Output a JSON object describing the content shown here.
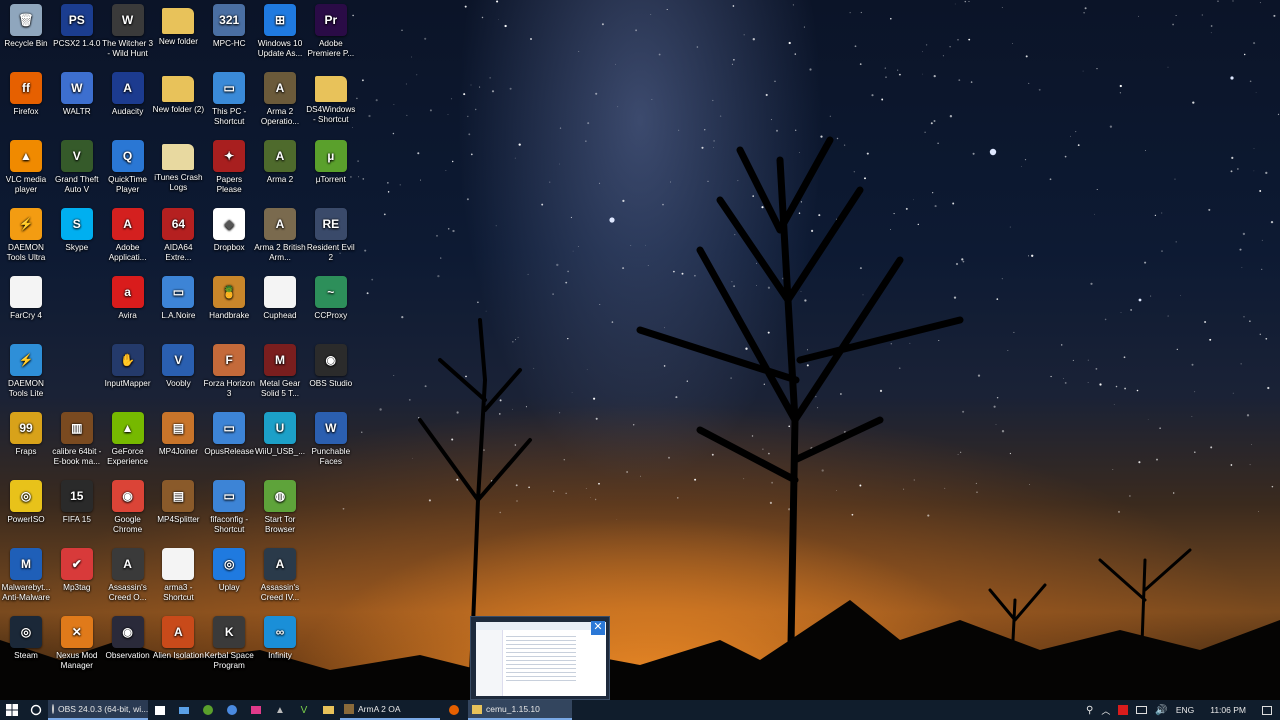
{
  "desktop": {
    "icons": [
      {
        "label": "Recycle Bin",
        "color": "#8fa6bd",
        "glyph": "🗑",
        "icon": "recycle-bin-icon"
      },
      {
        "label": "PCSX2 1.4.0",
        "color": "#1b3d8f",
        "glyph": "PS",
        "icon": "pcsx2-icon"
      },
      {
        "label": "The Witcher 3 - Wild Hunt",
        "color": "#3a3a3a",
        "glyph": "W",
        "icon": "witcher-icon"
      },
      {
        "label": "New folder",
        "color": "#e8c25a",
        "glyph": "",
        "icon": "folder-icon"
      },
      {
        "label": "MPC-HC",
        "color": "#4a6fa3",
        "glyph": "321",
        "icon": "mpc-hc-icon"
      },
      {
        "label": "Windows 10 Update As...",
        "color": "#1f7ae0",
        "glyph": "⊞",
        "icon": "windows-update-icon"
      },
      {
        "label": "Adobe Premiere P...",
        "color": "#2a0b46",
        "glyph": "Pr",
        "icon": "premiere-icon"
      },
      {
        "label": "Firefox",
        "color": "#e66000",
        "glyph": "ff",
        "icon": "firefox-icon"
      },
      {
        "label": "WALTR",
        "color": "#3d6fcf",
        "glyph": "W",
        "icon": "waltr-icon"
      },
      {
        "label": "Audacity",
        "color": "#1c3b8f",
        "glyph": "A",
        "icon": "audacity-icon"
      },
      {
        "label": "New folder (2)",
        "color": "#e8c25a",
        "glyph": "",
        "icon": "folder-icon"
      },
      {
        "label": "This PC - Shortcut",
        "color": "#3a8ad8",
        "glyph": "▭",
        "icon": "this-pc-icon"
      },
      {
        "label": "Arma 2 Operatio...",
        "color": "#6b5a3a",
        "glyph": "A",
        "icon": "arma-icon"
      },
      {
        "label": "DS4Windows - Shortcut",
        "color": "#e8c25a",
        "glyph": "",
        "icon": "folder-icon"
      },
      {
        "label": "VLC media player",
        "color": "#f08a00",
        "glyph": "▲",
        "icon": "vlc-icon"
      },
      {
        "label": "Grand Theft Auto V",
        "color": "#355a2a",
        "glyph": "V",
        "icon": "gta-icon"
      },
      {
        "label": "QuickTime Player",
        "color": "#2a77d4",
        "glyph": "Q",
        "icon": "quicktime-icon"
      },
      {
        "label": "iTunes Crash Logs",
        "color": "#e8d9a0",
        "glyph": "",
        "icon": "folder-icon"
      },
      {
        "label": "Papers Please",
        "color": "#a81f1f",
        "glyph": "✦",
        "icon": "papers-please-icon"
      },
      {
        "label": "Arma 2",
        "color": "#4e6a2c",
        "glyph": "A",
        "icon": "arma-icon"
      },
      {
        "label": "µTorrent",
        "color": "#5aa02c",
        "glyph": "µ",
        "icon": "utorrent-icon"
      },
      {
        "label": "DAEMON Tools Ultra",
        "color": "#f39c12",
        "glyph": "⚡",
        "icon": "daemon-tools-icon"
      },
      {
        "label": "Skype",
        "color": "#00aff0",
        "glyph": "S",
        "icon": "skype-icon"
      },
      {
        "label": "Adobe Applicati...",
        "color": "#d4201f",
        "glyph": "A",
        "icon": "adobe-icon"
      },
      {
        "label": "AIDA64 Extre...",
        "color": "#b52020",
        "glyph": "64",
        "icon": "aida64-icon"
      },
      {
        "label": "Dropbox",
        "color": "#ffffff",
        "glyph": "◆",
        "icon": "dropbox-icon",
        "dark": true
      },
      {
        "label": "Arma 2 British Arm...",
        "color": "#7a6a4e",
        "glyph": "A",
        "icon": "arma-icon"
      },
      {
        "label": "Resident Evil 2",
        "color": "#3a4a6a",
        "glyph": "RE",
        "icon": "resident-evil-icon"
      },
      {
        "label": "FarCry 4",
        "color": "#f4f4f4",
        "glyph": "",
        "icon": "file-icon",
        "dark": true
      },
      {
        "label": "",
        "color": "transparent",
        "glyph": "",
        "icon": "empty-slot",
        "empty": true
      },
      {
        "label": "Avira",
        "color": "#d91c1c",
        "glyph": "a",
        "icon": "avira-icon"
      },
      {
        "label": "L.A.Noire",
        "color": "#3d84d6",
        "glyph": "▭",
        "icon": "la-noire-icon"
      },
      {
        "label": "Handbrake",
        "color": "#c9862a",
        "glyph": "🍍",
        "icon": "handbrake-icon"
      },
      {
        "label": "Cuphead",
        "color": "#f4f4f4",
        "glyph": "",
        "icon": "file-icon",
        "dark": true
      },
      {
        "label": "CCProxy",
        "color": "#2d8f5a",
        "glyph": "~",
        "icon": "ccproxy-icon"
      },
      {
        "label": "DAEMON Tools Lite",
        "color": "#2e8fd8",
        "glyph": "⚡",
        "icon": "daemon-tools-icon"
      },
      {
        "label": "",
        "color": "transparent",
        "glyph": "",
        "icon": "empty-slot",
        "empty": true
      },
      {
        "label": "InputMapper",
        "color": "#243a6b",
        "glyph": "✋",
        "icon": "inputmapper-icon"
      },
      {
        "label": "Voobly",
        "color": "#2a5fb0",
        "glyph": "V",
        "icon": "voobly-icon"
      },
      {
        "label": "Forza Horizon 3",
        "color": "#c46a3a",
        "glyph": "F",
        "icon": "forza-icon"
      },
      {
        "label": "Metal Gear Solid 5 T...",
        "color": "#7a1e1e",
        "glyph": "M",
        "icon": "metal-gear-icon"
      },
      {
        "label": "OBS Studio",
        "color": "#2b2b2b",
        "glyph": "◉",
        "icon": "obs-icon"
      },
      {
        "label": "Fraps",
        "color": "#d8a21a",
        "glyph": "99",
        "icon": "fraps-icon"
      },
      {
        "label": "calibre 64bit - E-book ma...",
        "color": "#7a4a20",
        "glyph": "▥",
        "icon": "calibre-icon"
      },
      {
        "label": "GeForce Experience",
        "color": "#76b900",
        "glyph": "▲",
        "icon": "geforce-icon"
      },
      {
        "label": "MP4Joiner",
        "color": "#c8742a",
        "glyph": "▤",
        "icon": "mp4joiner-icon"
      },
      {
        "label": "OpusRelease",
        "color": "#3d84d6",
        "glyph": "▭",
        "icon": "opusrelease-icon"
      },
      {
        "label": "WiiU_USB_...",
        "color": "#1ca0c8",
        "glyph": "U",
        "icon": "wiiu-icon"
      },
      {
        "label": "Punchable Faces",
        "color": "#2b5fb0",
        "glyph": "W",
        "icon": "word-doc-icon"
      },
      {
        "label": "PowerISO",
        "color": "#e8c21a",
        "glyph": "◎",
        "icon": "poweriso-icon"
      },
      {
        "label": "FIFA 15",
        "color": "#2a2a2a",
        "glyph": "15",
        "icon": "fifa-icon"
      },
      {
        "label": "Google Chrome",
        "color": "#db4437",
        "glyph": "◉",
        "icon": "chrome-icon"
      },
      {
        "label": "MP4Splitter",
        "color": "#8a5a2a",
        "glyph": "▤",
        "icon": "mp4splitter-icon"
      },
      {
        "label": "fifaconfig - Shortcut",
        "color": "#3d84d6",
        "glyph": "▭",
        "icon": "fifaconfig-icon"
      },
      {
        "label": "Start Tor Browser",
        "color": "#5ea33a",
        "glyph": "◍",
        "icon": "tor-icon"
      },
      {
        "label": "",
        "color": "transparent",
        "glyph": "",
        "icon": "empty-slot",
        "empty": true
      },
      {
        "label": "Malwarebyt... Anti-Malware",
        "color": "#1f5fb8",
        "glyph": "M",
        "icon": "malwarebytes-icon"
      },
      {
        "label": "Mp3tag",
        "color": "#d83a3a",
        "glyph": "✔",
        "icon": "mp3tag-icon"
      },
      {
        "label": "Assassin's Creed O...",
        "color": "#3a3a3a",
        "glyph": "A",
        "icon": "assassins-creed-icon"
      },
      {
        "label": "arma3 - Shortcut",
        "color": "#f4f4f4",
        "glyph": "",
        "icon": "file-icon",
        "dark": true
      },
      {
        "label": "Uplay",
        "color": "#1f7ae0",
        "glyph": "◎",
        "icon": "uplay-icon"
      },
      {
        "label": "Assassin's Creed IV...",
        "color": "#2a3a4a",
        "glyph": "A",
        "icon": "assassins-creed-icon"
      },
      {
        "label": "",
        "color": "transparent",
        "glyph": "",
        "icon": "empty-slot",
        "empty": true
      },
      {
        "label": "Steam",
        "color": "#1b2838",
        "glyph": "◎",
        "icon": "steam-icon"
      },
      {
        "label": "Nexus Mod Manager",
        "color": "#e07a1a",
        "glyph": "✕",
        "icon": "nexus-icon"
      },
      {
        "label": "Observation",
        "color": "#2a2a3a",
        "glyph": "◉",
        "icon": "observation-icon"
      },
      {
        "label": "Alien Isolation",
        "color": "#c84a1a",
        "glyph": "A",
        "icon": "alien-isolation-icon"
      },
      {
        "label": "Kerbal Space Program",
        "color": "#3a3a3a",
        "glyph": "K",
        "icon": "kerbal-icon"
      },
      {
        "label": "Infinity",
        "color": "#1a8fd8",
        "glyph": "∞",
        "icon": "infinity-icon"
      },
      {
        "label": "",
        "color": "transparent",
        "glyph": "",
        "icon": "empty-slot",
        "empty": true
      }
    ]
  },
  "taskbar": {
    "obs_task": "OBS 24.0.3 (64-bit, wi...",
    "arma_task": "ArmA 2 OA",
    "explorer_task": "cemu_1.15.10",
    "language": "ENG",
    "time": "11:06 PM"
  },
  "colors": {
    "taskbar": "#101d2c",
    "accent": "#2b78d6"
  }
}
